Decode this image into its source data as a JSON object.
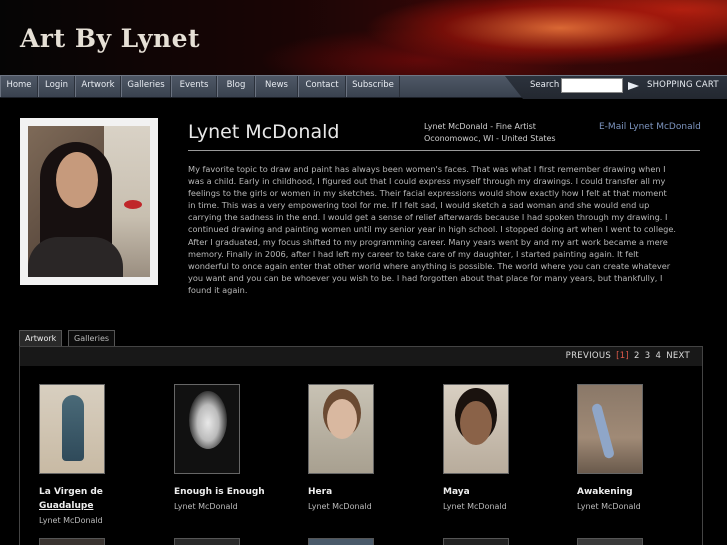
{
  "site": {
    "title": "Art By Lynet"
  },
  "nav": {
    "items": [
      "Home",
      "Login",
      "Artwork",
      "Galleries",
      "Events",
      "Blog",
      "News",
      "Contact",
      "Subscribe"
    ],
    "search_label": "Search",
    "search_value": "",
    "cart_label": "SHOPPING CART"
  },
  "profile": {
    "name": "Lynet McDonald",
    "meta_line1": "Lynet McDonald - Fine Artist",
    "meta_line2": "Oconomowoc, WI - United States",
    "email_link": "E-Mail Lynet McDonald",
    "bio": "My favorite topic to draw and paint has always been women's faces. That was what I first remember drawing when I was a child. Early in childhood, I figured out that I could express myself through my drawings. I could transfer all my feelings to the girls or women in my sketches. Their facial expressions would show exactly how I felt at that moment in time. This was a very empowering tool for me. If I felt sad, I would sketch a sad woman and she would end up carrying the sadness in the end. I would get a sense of relief afterwards because I had spoken through my drawing. I continued drawing and painting women until my senior year in high school. I stopped doing art when I went to college. After I graduated, my focus shifted to my programming career. Many years went by and my art work became a mere memory. Finally in 2006, after I had left my career to take care of my daughter, I started painting again. It felt wonderful to once again enter that other world where anything is possible. The world where you can create whatever you want and you can be whoever you wish to be. I had forgotten about that place for many years, but thankfully, I found it again."
  },
  "tabs": [
    {
      "label": "Artwork",
      "active": true
    },
    {
      "label": "Galleries",
      "active": false
    }
  ],
  "pager": {
    "previous": "PREVIOUS",
    "current": "[1]",
    "pages": [
      "2",
      "3",
      "4"
    ],
    "next": "NEXT"
  },
  "artworks": [
    {
      "title": "La Virgen de Guadalupe",
      "artist": "Lynet McDonald"
    },
    {
      "title": "Enough is Enough",
      "artist": "Lynet McDonald"
    },
    {
      "title": "Hera",
      "artist": "Lynet McDonald"
    },
    {
      "title": "Maya",
      "artist": "Lynet McDonald"
    },
    {
      "title": "Awakening",
      "artist": "Lynet McDonald"
    }
  ]
}
